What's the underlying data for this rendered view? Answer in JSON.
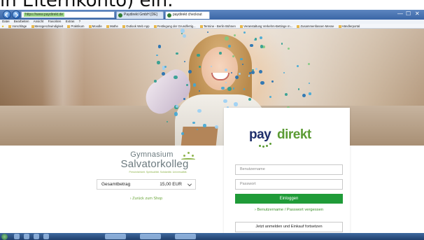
{
  "caption": "in Elternkonto) ein.",
  "browser": {
    "address": "https://www.paydirekt.de",
    "tabs": [
      {
        "label": "Paydirekt GmbH [DE]",
        "active": false
      },
      {
        "label": "paydirekt checkout",
        "active": true
      }
    ],
    "window_controls": [
      "—",
      "☐",
      "✕"
    ],
    "menu": [
      "Datei",
      "Bearbeiten",
      "Ansicht",
      "Favoriten",
      "Extras",
      "?"
    ],
    "favorites": [
      "Vorschläge",
      "Messgeschwindigkeit",
      "Praktikum",
      "Moodle",
      "Mathe",
      "Outlook Web App",
      "Festlegung der Grundfertig...",
      "Termine - Berlin Bühnen",
      "Veranstaltung Verkehrs-Bettinge m...",
      "Zusammenfassen Messe",
      "Händlerportal"
    ]
  },
  "merchant": {
    "line1": "Gymnasium",
    "line2": "Salvatorkolleg",
    "tagline": "Persönlichkeit. Spiritualität. Solidarität. Universalität.",
    "total_label": "Gesamtbetrag",
    "total_amount": "15,00 EUR",
    "back_link": "› Zurück zum Shop"
  },
  "login": {
    "logo_pay": "pay",
    "logo_direkt": "direkt",
    "username_placeholder": "Benutzername",
    "password_placeholder": "Passwort",
    "login_button": "Einloggen",
    "forgot_link": "› Benutzername / Passwort vergessen",
    "register_button": "Jetzt anmelden und Einkauf fortsetzen"
  },
  "colors": {
    "brand_green": "#1f9b38",
    "brand_navy": "#1f2f6b",
    "link_green": "#3c8f2a"
  },
  "icons": [
    "back-icon",
    "forward-icon",
    "favorites-star-icon",
    "chevron-down-icon",
    "start-icon"
  ]
}
